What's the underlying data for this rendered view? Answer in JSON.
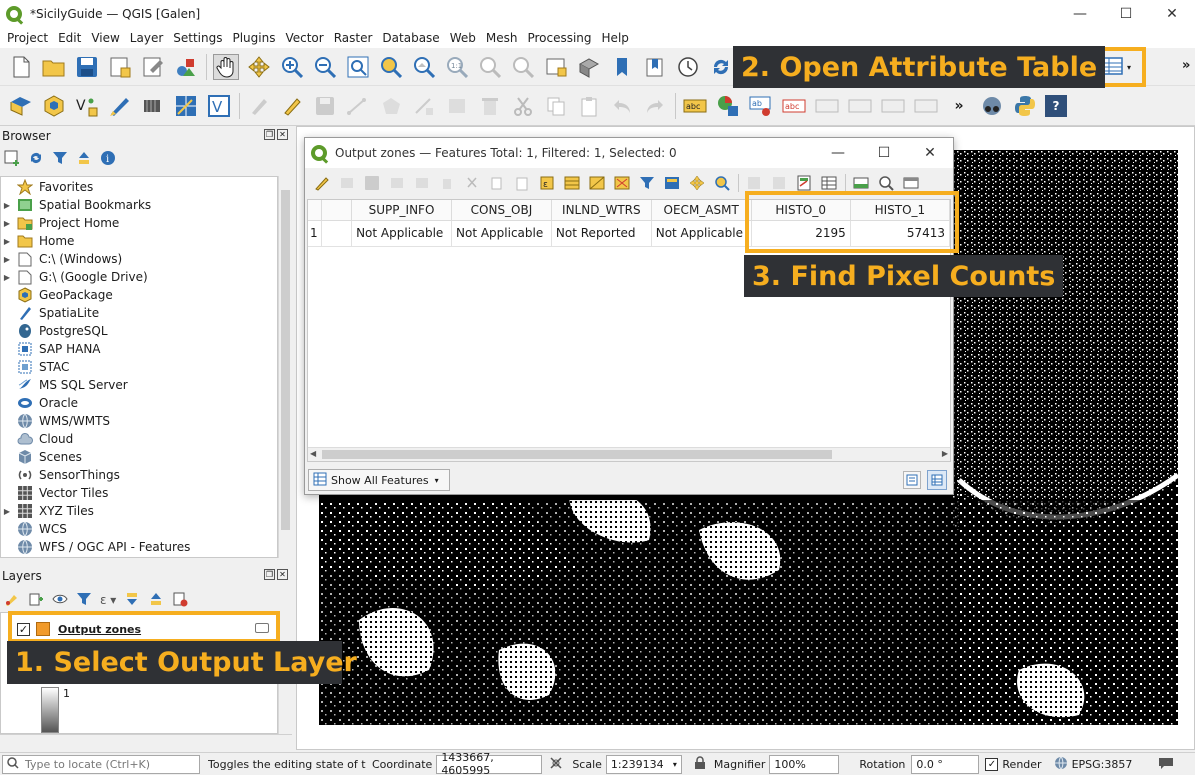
{
  "window": {
    "title": "*SicilyGuide — QGIS [Galen]",
    "controls": [
      "—",
      "☐",
      "✕"
    ]
  },
  "menu": [
    "Project",
    "Edit",
    "View",
    "Layer",
    "Settings",
    "Plugins",
    "Vector",
    "Raster",
    "Database",
    "Web",
    "Mesh",
    "Processing",
    "Help"
  ],
  "browser": {
    "title": "Browser",
    "items": [
      {
        "label": "Favorites",
        "icon": "star-icon",
        "arrow": ""
      },
      {
        "label": "Spatial Bookmarks",
        "icon": "bookmark-icon",
        "arrow": "▶"
      },
      {
        "label": "Project Home",
        "icon": "folder-green-icon",
        "arrow": "▶"
      },
      {
        "label": "Home",
        "icon": "folder-icon",
        "arrow": "▶"
      },
      {
        "label": "C:\\ (Windows)",
        "icon": "drive-icon",
        "arrow": "▶"
      },
      {
        "label": "G:\\ (Google Drive)",
        "icon": "drive-icon",
        "arrow": "▶"
      },
      {
        "label": "GeoPackage",
        "icon": "geopackage-icon",
        "arrow": ""
      },
      {
        "label": "SpatiaLite",
        "icon": "spatialite-icon",
        "arrow": ""
      },
      {
        "label": "PostgreSQL",
        "icon": "postgresql-icon",
        "arrow": ""
      },
      {
        "label": "SAP HANA",
        "icon": "sap-hana-icon",
        "arrow": ""
      },
      {
        "label": "STAC",
        "icon": "stac-icon",
        "arrow": ""
      },
      {
        "label": "MS SQL Server",
        "icon": "mssql-icon",
        "arrow": ""
      },
      {
        "label": "Oracle",
        "icon": "oracle-icon",
        "arrow": ""
      },
      {
        "label": "WMS/WMTS",
        "icon": "wms-globe-icon",
        "arrow": ""
      },
      {
        "label": "Cloud",
        "icon": "cloud-icon",
        "arrow": ""
      },
      {
        "label": "Scenes",
        "icon": "scenes-icon",
        "arrow": ""
      },
      {
        "label": "SensorThings",
        "icon": "sensor-icon",
        "arrow": ""
      },
      {
        "label": "Vector Tiles",
        "icon": "vector-tiles-icon",
        "arrow": ""
      },
      {
        "label": "XYZ Tiles",
        "icon": "xyz-tiles-icon",
        "arrow": "▶"
      },
      {
        "label": "WCS",
        "icon": "wcs-globe-icon",
        "arrow": ""
      },
      {
        "label": "WFS / OGC API - Features",
        "icon": "wfs-globe-icon",
        "arrow": ""
      }
    ]
  },
  "layers": {
    "title": "Layers",
    "layer_name": "Output zones",
    "legend_value": "1"
  },
  "attribute_table": {
    "title": "Output zones — Features Total: 1, Filtered: 1, Selected: 0",
    "columns": [
      "SUPP_INFO",
      "CONS_OBJ",
      "INLND_WTRS",
      "OECM_ASMT",
      "HISTO_0",
      "HISTO_1"
    ],
    "rows": [
      {
        "row_num": "1",
        "cells": [
          "Not Applicable",
          "Not Applicable",
          "Not Reported",
          "Not Applicable",
          "2195",
          "57413"
        ]
      }
    ],
    "show_all_label": "Show All Features"
  },
  "annotations": {
    "step1": "1. Select Output Layer",
    "step2": "2. Open Attribute Table",
    "step3": "3. Find Pixel Counts",
    "highlight_color": "#f6ae1f",
    "callout_bg": "#2f3135"
  },
  "statusbar": {
    "locate_placeholder": "Type to locate (Ctrl+K)",
    "message": "Toggles the editing state of the c",
    "coordinate_label": "Coordinate",
    "coordinate_value": "1433667, 4605995",
    "scale_label": "Scale",
    "scale_value": "1:239134",
    "magnifier_label": "Magnifier",
    "magnifier_value": "100%",
    "rotation_label": "Rotation",
    "rotation_value": "0.0 °",
    "render_label": "Render",
    "crs": "EPSG:3857"
  }
}
